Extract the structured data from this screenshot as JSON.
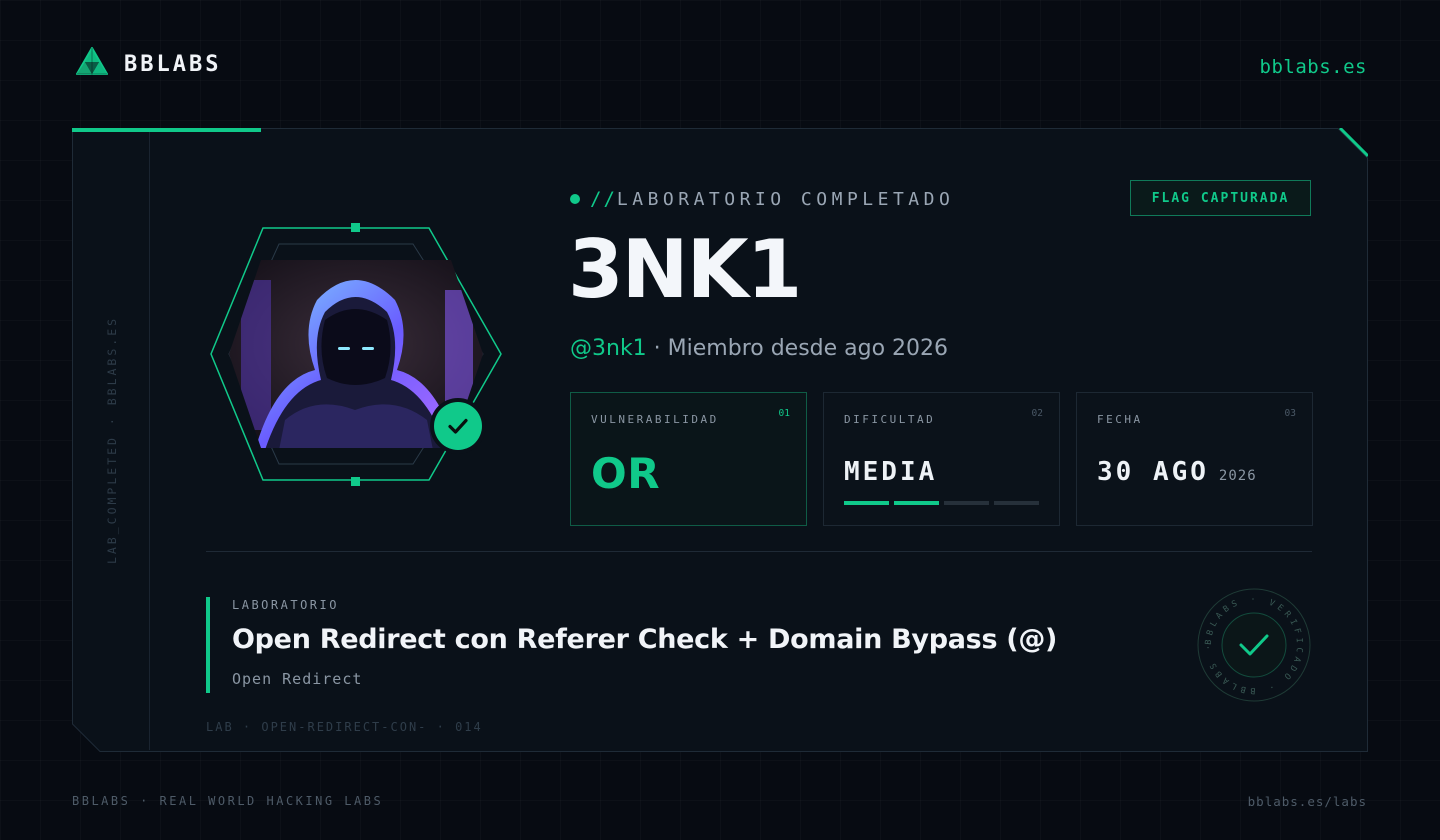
{
  "header": {
    "brand_name": "BBLABS",
    "site_link": "bblabs.es",
    "logo_icon": "bblabs-logo-icon"
  },
  "card": {
    "side_text": "LAB_COMPLETED · BBLABS.ES",
    "status_slashes": "//",
    "status_text": "LABORATORIO COMPLETADO",
    "flag_label": "FLAG CAPTURADA",
    "user": {
      "name": "3NK1",
      "handle": "@3nk1",
      "member_since": " · Miembro desde ago 2026"
    },
    "stats": [
      {
        "label": "VULNERABILIDAD",
        "num": "01",
        "value": "OR"
      },
      {
        "label": "DIFICULTAD",
        "num": "02",
        "value": "MEDIA",
        "level": 2,
        "max": 4
      },
      {
        "label": "FECHA",
        "num": "03",
        "value": "30 AGO",
        "year": "2026"
      }
    ],
    "lab": {
      "label": "LABORATORIO",
      "title": "Open Redirect con Referer Check + Domain Bypass (@)",
      "subtitle": "Open Redirect",
      "code": "LAB · OPEN-REDIRECT-CON- · 014"
    },
    "seal_text": "BBLABS · VERIFICADO · BBLABS ·"
  },
  "footer": {
    "left": "BBLABS · REAL WORLD HACKING LABS",
    "right": "bblabs.es/labs"
  },
  "colors": {
    "accent": "#10c98a",
    "background": "#070b12",
    "card": "#0a1119"
  }
}
